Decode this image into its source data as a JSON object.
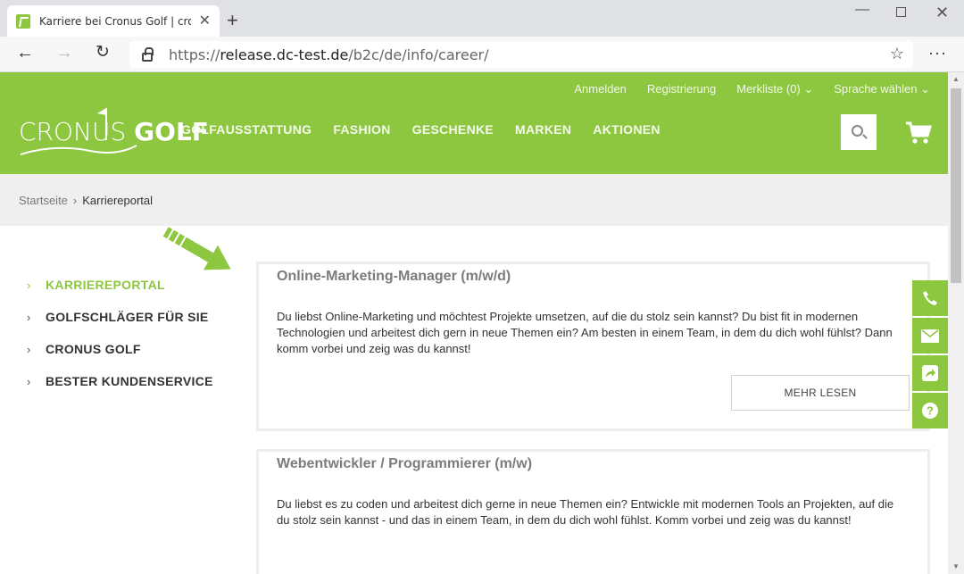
{
  "browser": {
    "tab_title": "Karriere bei Cronus Golf | cronus",
    "tab_close": "✕",
    "new_tab": "+",
    "url_prefix": "https://",
    "url_host": "release.dc-test.de",
    "url_path": "/b2c/de/info/career/"
  },
  "header": {
    "top_links": [
      "Anmelden",
      "Registrierung",
      "Merkliste (0) ⌄",
      "Sprache wählen ⌄"
    ],
    "logo_part1": "CRONUS",
    "logo_part2": "GOLF",
    "nav": [
      "GOLFAUSSTATTUNG",
      "FASHION",
      "GESCHENKE",
      "MARKEN",
      "AKTIONEN"
    ]
  },
  "breadcrumb": {
    "home": "Startseite",
    "separator": "›",
    "current": "Karriereportal"
  },
  "sidebar": {
    "items": [
      {
        "label": "KARRIEREPORTAL",
        "active": true
      },
      {
        "label": "GOLFSCHLÄGER FÜR SIE",
        "active": false
      },
      {
        "label": "CRONUS GOLF",
        "active": false
      },
      {
        "label": "BESTER KUNDENSERVICE",
        "active": false
      }
    ]
  },
  "jobs": [
    {
      "title": "Online-Marketing-Manager (m/w/d)",
      "description": "Du liebst Online-Marketing und möchtest Projekte umsetzen, auf die du stolz sein kannst? Du bist fit in modernen Technologien und arbeitest dich gern in neue Themen ein? Am besten in einem Team, in dem du dich wohl fühlst? Dann komm vorbei und zeig was du kannst!",
      "button": "MEHR LESEN"
    },
    {
      "title": "Webentwickler / Programmierer (m/w)",
      "description": "Du liebst es zu coden und arbeitest dich gerne in neue Themen ein? Entwickle mit modernen Tools an Projekten, auf die du stolz sein kannst - und das in einem Team, in dem du dich wohl fühlst. Komm vorbei und zeig was du kannst!"
    }
  ],
  "side_actions": [
    "phone-icon",
    "email-icon",
    "share-icon",
    "help-icon"
  ],
  "colors": {
    "brand": "#8dc63f",
    "breadcrumb_bg": "#efefef"
  }
}
